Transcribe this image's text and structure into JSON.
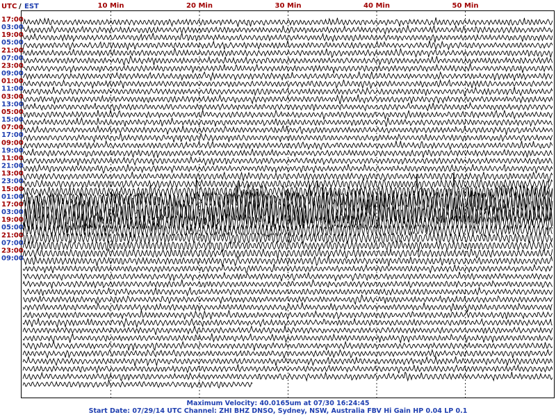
{
  "header": {
    "utc_label": "UTC",
    "separator": "/",
    "est_label": "EST"
  },
  "colors": {
    "utc": "#a00000",
    "est": "#1f3fb0",
    "trace": "#000000",
    "footer": "#1f3fb0",
    "grid": "#000000"
  },
  "chart_data": {
    "type": "line",
    "minute_ticks": [
      "10 Min",
      "20 Min",
      "30 Min",
      "40 Min",
      "50 Min"
    ],
    "minute_tick_values": [
      10,
      20,
      30,
      40,
      50
    ],
    "xlim": [
      0,
      60
    ],
    "rows": 48,
    "row_duration_min": 60,
    "time_labels": [
      {
        "utc": "17:00",
        "est": "03:00",
        "row": 0
      },
      {
        "utc": "19:00",
        "est": "05:00",
        "row": 2
      },
      {
        "utc": "21:00",
        "est": "07:00",
        "row": 4
      },
      {
        "utc": "23:00",
        "est": "09:00",
        "row": 6
      },
      {
        "utc": "01:00",
        "est": "11:00",
        "row": 8
      },
      {
        "utc": "03:00",
        "est": "13:00",
        "row": 10
      },
      {
        "utc": "05:00",
        "est": "15:00",
        "row": 12
      },
      {
        "utc": "07:00",
        "est": "17:00",
        "row": 14
      },
      {
        "utc": "09:00",
        "est": "19:00",
        "row": 16
      },
      {
        "utc": "11:00",
        "est": "21:00",
        "row": 18
      },
      {
        "utc": "13:00",
        "est": "23:00",
        "row": 20
      },
      {
        "utc": "15:00",
        "est": "01:00",
        "row": 22
      },
      {
        "utc": "17:00",
        "est": "03:00",
        "row": 24
      },
      {
        "utc": "19:00",
        "est": "05:00",
        "row": 26
      },
      {
        "utc": "21:00",
        "est": "07:00",
        "row": 28
      },
      {
        "utc": "23:00",
        "est": "09:00",
        "row": 30
      }
    ],
    "earthquake_window": {
      "start_row": 20,
      "end_row": 31,
      "peak_row": 24,
      "peak_minute": 26.5
    }
  },
  "footer": {
    "line1": "Maximum Velocity: 40.0165um at 07/30 16:24:45",
    "line2": "Start Date: 07/29/14 UTC Channel: ZHI  BHZ  DNSO, Sydney, NSW, Australia  FBV Hi Gain HP 0.04 LP 0.1"
  }
}
